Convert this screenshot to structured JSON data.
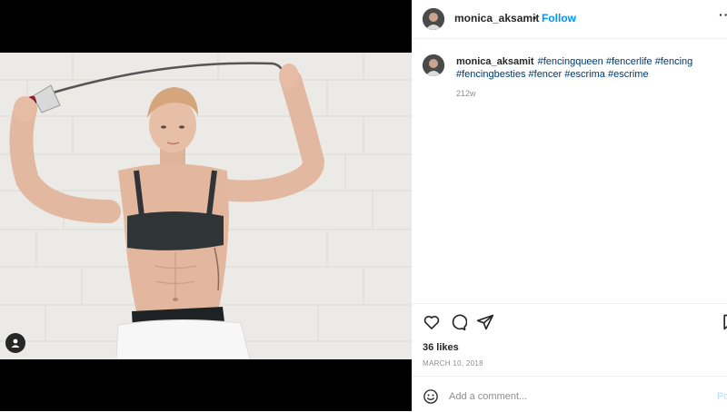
{
  "post": {
    "username": "monica_aksamit",
    "follow_label": "Follow",
    "separator": "•",
    "more": "··",
    "caption_hashtags": [
      "#fencingqueen",
      "#fencerlife",
      "#fencing",
      "#fencingbesties",
      "#fencer",
      "#escrima",
      "#escrime"
    ],
    "time_ago": "212w",
    "likes": "36 likes",
    "date": "MARCH 10, 2018",
    "comment_placeholder": "Add a comment...",
    "post_label": "Po"
  },
  "icons": {
    "like": "heart-icon",
    "comment": "comment-icon",
    "share": "paper-plane-icon",
    "save": "bookmark-icon",
    "emoji": "smiley-icon",
    "tag": "user-tag-icon"
  },
  "colors": {
    "link_blue": "#0095f6",
    "hashtag": "#00376b",
    "muted": "#8e8e8e",
    "text": "#262626"
  }
}
